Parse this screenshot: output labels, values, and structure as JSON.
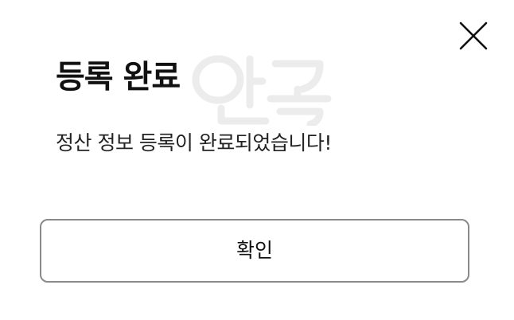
{
  "dialog": {
    "title": "등록 완료",
    "message": "정산 정보 등록이 완료되었습니다!",
    "confirm_label": "확인",
    "close_icon": "close-icon",
    "watermark_icon": "watermark-logo"
  },
  "colors": {
    "background": "#ffffff",
    "text": "#111111",
    "button_border": "#8a8a8a",
    "watermark": "#ececec"
  }
}
